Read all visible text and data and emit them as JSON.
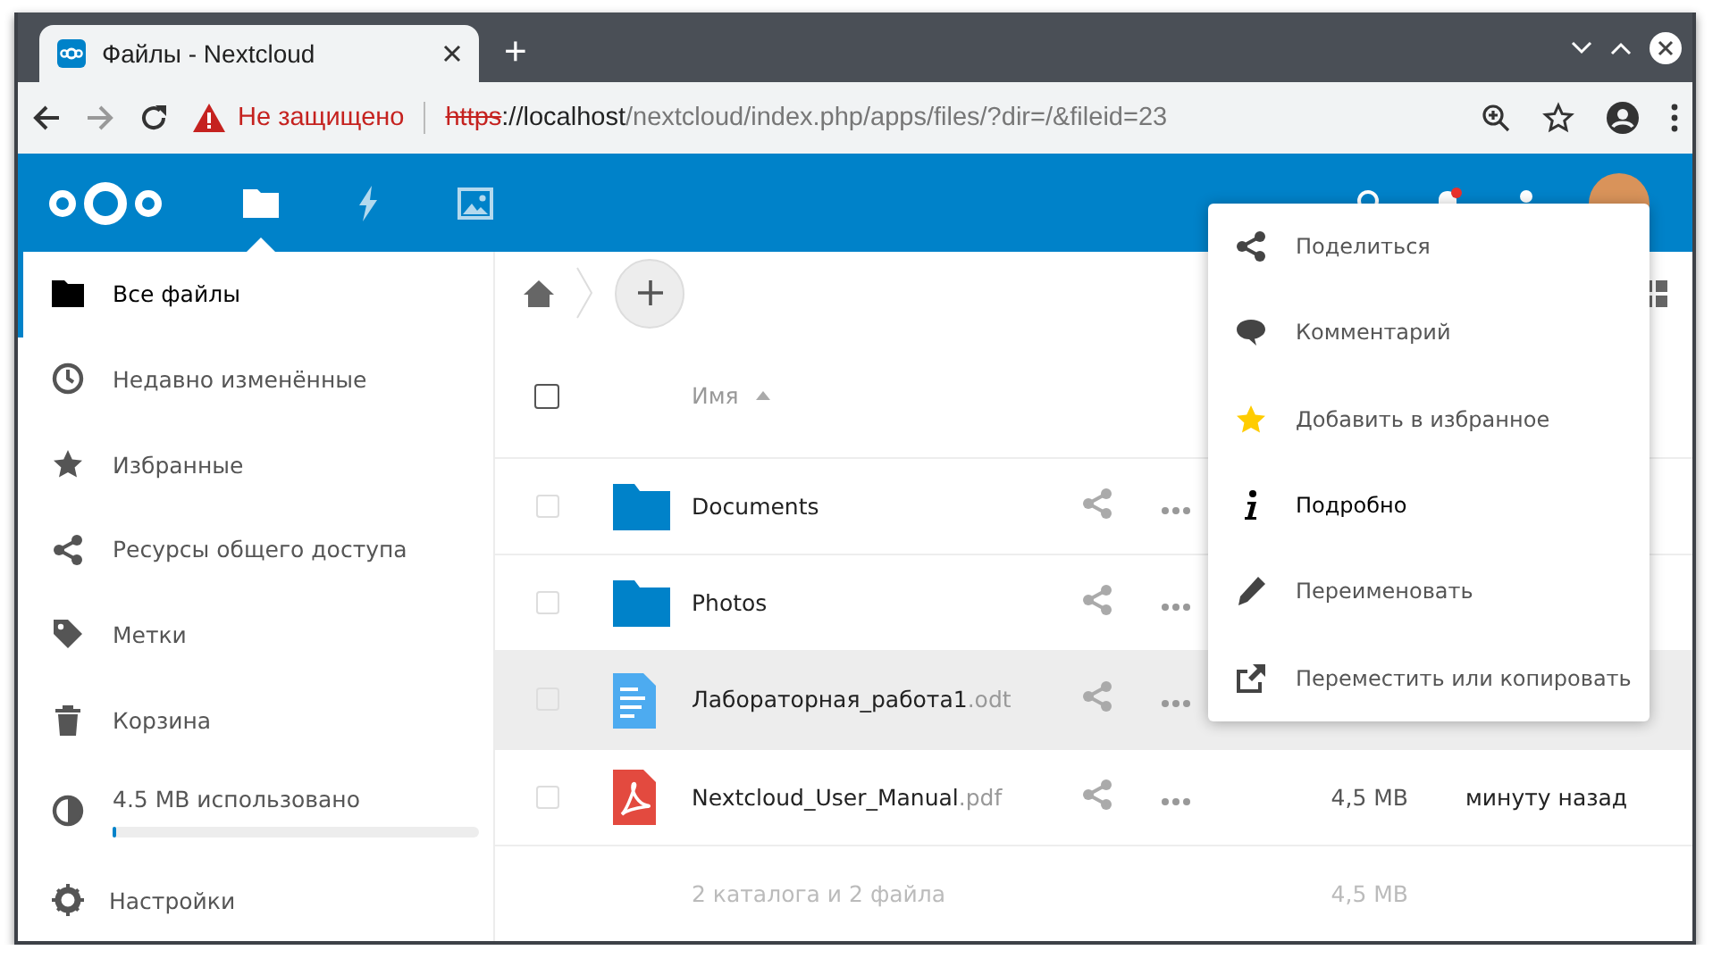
{
  "browser": {
    "tab_title": "Файлы - Nextcloud",
    "new_tab": "+",
    "security": "Не защищено",
    "url_scheme": "https",
    "url_host": "://localhost",
    "url_path": "/nextcloud/index.php/apps/files/?dir=/&fileid=23"
  },
  "app_header": {
    "apps": [
      {
        "kind": "files",
        "selected": true
      },
      {
        "kind": "activity",
        "selected": false
      },
      {
        "kind": "gallery",
        "selected": false
      }
    ],
    "notification_unread": true
  },
  "sidebar": {
    "items": [
      {
        "kind": "folder",
        "label": "Все файлы",
        "selected": true
      },
      {
        "kind": "clock",
        "label": "Недавно изменённые",
        "selected": false
      },
      {
        "kind": "star",
        "label": "Избранные",
        "selected": false
      },
      {
        "kind": "share",
        "label": "Ресурсы общего доступа",
        "selected": false
      },
      {
        "kind": "tag",
        "label": "Метки",
        "selected": false
      },
      {
        "kind": "trash",
        "label": "Корзина",
        "selected": false
      }
    ],
    "quota": {
      "label": "4.5 MB использовано",
      "level": 0.01
    },
    "settings": "Настройки"
  },
  "files": {
    "select_all_checked": false,
    "name_column": "Имя",
    "rows": [
      {
        "kind": "folder",
        "name": "Documents",
        "checked": false,
        "highlighted": false
      },
      {
        "kind": "folder",
        "name": "Photos",
        "checked": false,
        "highlighted": false
      },
      {
        "kind": "document",
        "name": "Лабораторная_работа1",
        "extension": ".odt",
        "checked": false,
        "highlighted": true
      },
      {
        "kind": "pdf",
        "name": "Nextcloud_User_Manual",
        "extension": ".pdf",
        "size": "4,5 MB",
        "modified": "минуту назад",
        "checked": false,
        "highlighted": false
      }
    ],
    "summary": {
      "text": "2 каталога и 2 файла",
      "size": "4,5 MB"
    }
  },
  "action_menu": {
    "items": [
      {
        "kind": "share",
        "label": "Поделиться",
        "highlighted": false
      },
      {
        "kind": "comment",
        "label": "Комментарий",
        "highlighted": false
      },
      {
        "kind": "star",
        "label": "Добавить в избранное",
        "highlighted": false
      },
      {
        "kind": "info",
        "label": "Подробно",
        "highlighted": true
      },
      {
        "kind": "pencil",
        "label": "Переименовать",
        "highlighted": false
      },
      {
        "kind": "move",
        "label": "Переместить или копировать",
        "highlighted": false
      }
    ]
  }
}
